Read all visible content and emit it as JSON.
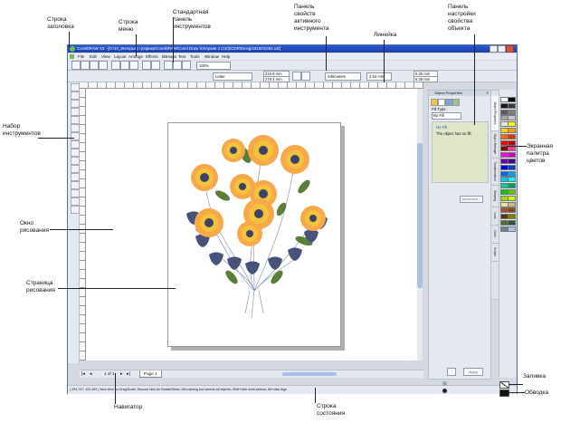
{
  "window": {
    "title": "CorelDRAW X3 - [D:\\10_Интерьер графики\\CorelDRAW\\Corel Draw X3\\Архив 2 (Ctrl)\\CDR\\Design\\3100\\2362.cdr]"
  },
  "menu": [
    "File",
    "Edit",
    "View",
    "Layout",
    "Arrange",
    "Effects",
    "Bitmaps",
    "Text",
    "Tools",
    "Window",
    "Help"
  ],
  "toolbar": {
    "zoom": "100%",
    "font": "Letter",
    "width": "215.9 mm",
    "height": "279.4 mm",
    "units": "millimeters",
    "nudge": "2.54 mm",
    "dup_x": "6.35 mm",
    "dup_y": "6.35 mm"
  },
  "docker": {
    "title": "Object Properties",
    "fill_type_label": "Fill Type:",
    "fill_type_value": "No Fill",
    "no_fill_title": "No Fill",
    "no_fill_desc": "The object has no fill",
    "advanced_button": "Advanced...",
    "apply_button": "Apply",
    "side_tabs": [
      "Object Properties",
      "Object Manager",
      "Transformation",
      "Shaping",
      "Lens",
      "Color",
      "Scripts"
    ]
  },
  "navigator": {
    "page_counter": "1 of 1",
    "page_tab": "Page 1"
  },
  "status": {
    "text": "( 293,747; 122,409 )   Next click for Drag/Scale; Second click for Rotate/Skew; Dbl-clicking tool selects all objects; Shift+click multi-selects; Alt+click digs"
  },
  "palette_colors": [
    "#ffffff",
    "#000000",
    "#1a1a1a",
    "#3a3a3a",
    "#5c5c5c",
    "#7f7f7f",
    "#a3a3a3",
    "#c8c8c8",
    "#e5e5e5",
    "#ffff00",
    "#ffd200",
    "#ff9c00",
    "#ff6a00",
    "#e53400",
    "#ff0000",
    "#c10000",
    "#8b0000",
    "#ff3c8c",
    "#ff00ff",
    "#c800c8",
    "#6e00b4",
    "#4b0082",
    "#0000ff",
    "#003cc8",
    "#0064ff",
    "#00a0ff",
    "#00c8ff",
    "#00ffff",
    "#00c8a0",
    "#00a05a",
    "#00c800",
    "#64c800",
    "#a0dc00",
    "#c8ff00",
    "#f0e68c",
    "#d2b48c",
    "#a0522d",
    "#8b4513",
    "#5a3214",
    "#808000",
    "#556b2f",
    "#2f4f4f",
    "#708090",
    "#b0c4de"
  ],
  "labels": {
    "title_bar": "Строка\nзаголовка",
    "menu_bar": "Строка\nменю",
    "std_toolbar": "Стандартная\nпанель\nинструментов",
    "property_bar": "Панель\nсвойств\nактивного\nинструмента",
    "ruler": "Линейка",
    "docker": "Панель\nнастройки\nсвойства\nобъекта",
    "toolbox": "Набор\nинструментов",
    "palette": "Экранная\nпалитра\nцветов",
    "drawing_window": "Окно\nрисования",
    "drawing_page": "Страница\nрисования",
    "navigator": "Навигатор",
    "status_bar": "Строка\nсостояния",
    "fill": "Заливка",
    "outline": "Обводка"
  }
}
